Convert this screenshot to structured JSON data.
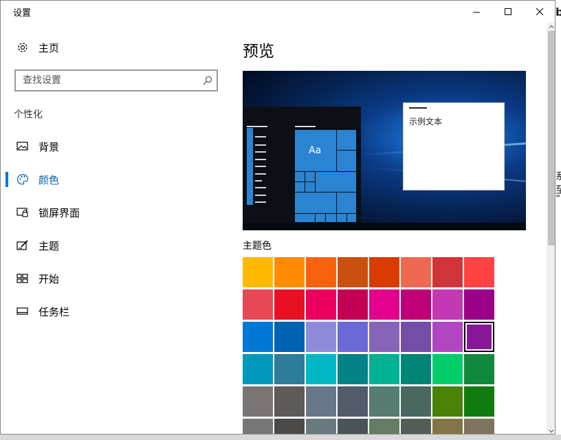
{
  "window": {
    "title": "设置"
  },
  "sidebar": {
    "home_label": "主页",
    "search_placeholder": "查找设置",
    "section_header": "个性化",
    "items": [
      {
        "label": "背景",
        "icon": "picture-icon",
        "active": false
      },
      {
        "label": "颜色",
        "icon": "palette-icon",
        "active": true
      },
      {
        "label": "锁屏界面",
        "icon": "lock-screen-icon",
        "active": false
      },
      {
        "label": "主题",
        "icon": "theme-brush-icon",
        "active": false
      },
      {
        "label": "开始",
        "icon": "start-tiles-icon",
        "active": false
      },
      {
        "label": "任务栏",
        "icon": "taskbar-icon",
        "active": false
      }
    ]
  },
  "main": {
    "title": "预览",
    "preview": {
      "tile_label": "Aa",
      "sample_text": "示例文本"
    },
    "accent_section_title": "主题色",
    "accent_color": "#0078d7",
    "swatches": [
      [
        "#FFB900",
        "#FF8C00",
        "#F7630C",
        "#CA5010",
        "#DA3B01",
        "#EF6950",
        "#D13438",
        "#FF4343"
      ],
      [
        "#E74856",
        "#E81123",
        "#EA005E",
        "#C30052",
        "#E3008C",
        "#BF0077",
        "#C239B3",
        "#9A0089"
      ],
      [
        "#0078D7",
        "#0063B1",
        "#8E8CD8",
        "#6B69D6",
        "#8764B8",
        "#744DA9",
        "#B146C2",
        "#881798"
      ],
      [
        "#0099BC",
        "#2D7D9A",
        "#00B7C3",
        "#038387",
        "#00B294",
        "#018574",
        "#00CC6A",
        "#10893E"
      ],
      [
        "#7A7574",
        "#5D5A58",
        "#68768A",
        "#515C6B",
        "#567C73",
        "#486860",
        "#498205",
        "#107C10"
      ],
      [
        "#767676",
        "#4C4A48",
        "#69797E",
        "#4A5459",
        "#647C64",
        "#525E54",
        "#847545",
        "#7E735F"
      ]
    ],
    "selected_swatch": "#881798"
  },
  "background_window": {
    "fragments": [
      "b",
      "系",
      "至",
      "”"
    ]
  }
}
